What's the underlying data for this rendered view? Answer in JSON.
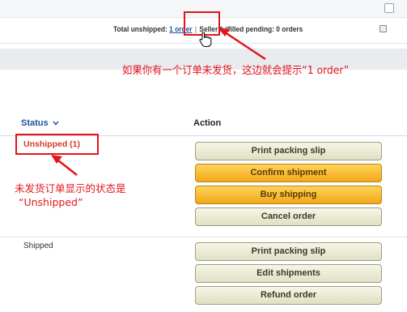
{
  "summary": {
    "prefix": "Total unshipped:",
    "unshipped_link": "1 order",
    "separator": "|",
    "pending": "Seller fulfilled pending: 0 orders"
  },
  "annotations": {
    "callout_order": "如果你有一个订单未发货，这边就会提示“1 order”",
    "callout_status_line1": "未发货订单显示的状态是",
    "callout_status_line2": "“Unshipped”",
    "highlight_color": "#e3141b"
  },
  "table": {
    "headers": {
      "status": "Status",
      "action": "Action"
    }
  },
  "orders": [
    {
      "status": "Unshipped (1)",
      "actions": [
        {
          "label": "Print packing slip",
          "style": "default"
        },
        {
          "label": "Confirm shipment",
          "style": "primary"
        },
        {
          "label": "Buy shipping",
          "style": "primary"
        },
        {
          "label": "Cancel order",
          "style": "default"
        }
      ]
    },
    {
      "status": "Shipped",
      "actions": [
        {
          "label": "Print packing slip",
          "style": "default"
        },
        {
          "label": "Edit shipments",
          "style": "default"
        },
        {
          "label": "Refund order",
          "style": "default"
        }
      ]
    }
  ],
  "colors": {
    "link": "#1b4f9c",
    "unshipped_status": "#d23c24",
    "primary_button": "#f2a619",
    "default_button": "#e0e0c6"
  },
  "icons": [
    "sort-chevron-down-icon",
    "mouse-cursor-icon",
    "callout-arrow-icon"
  ]
}
